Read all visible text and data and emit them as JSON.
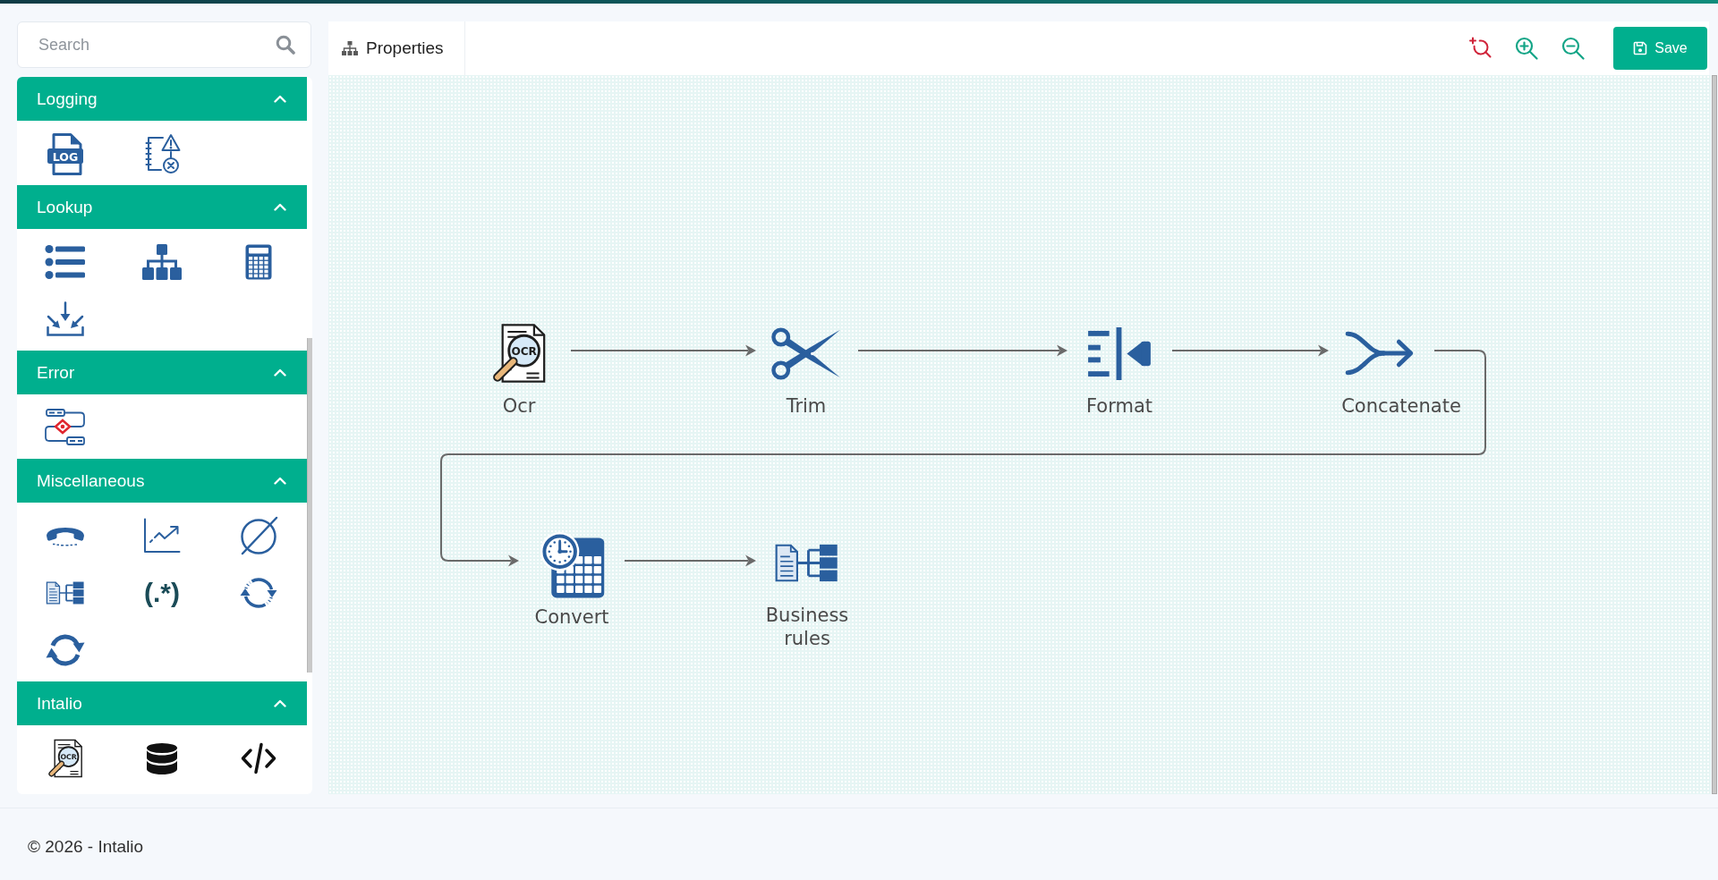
{
  "search": {
    "placeholder": "Search"
  },
  "sidebar": {
    "sections": [
      {
        "title": "Logging",
        "expanded": true,
        "items": [
          {
            "kind": "log",
            "badge": "LOG"
          },
          {
            "kind": "warning"
          }
        ]
      },
      {
        "title": "Lookup",
        "expanded": true,
        "items": [
          {
            "kind": "list"
          },
          {
            "kind": "tree"
          },
          {
            "kind": "calculator"
          },
          {
            "kind": "inbox"
          }
        ]
      },
      {
        "title": "Error",
        "expanded": true,
        "items": [
          {
            "kind": "errorflow"
          }
        ]
      },
      {
        "title": "Miscellaneous",
        "expanded": true,
        "items": [
          {
            "kind": "phone"
          },
          {
            "kind": "chart"
          },
          {
            "kind": "nullset"
          },
          {
            "kind": "rules"
          },
          {
            "kind": "regex",
            "glyph": "(.*)"
          },
          {
            "kind": "dashedsync"
          },
          {
            "kind": "sync"
          }
        ]
      },
      {
        "title": "Intalio",
        "expanded": true,
        "items": [
          {
            "kind": "ocr",
            "badge": "OCR"
          },
          {
            "kind": "database"
          },
          {
            "kind": "code"
          }
        ]
      }
    ]
  },
  "toolbar": {
    "tab": {
      "label": "Properties"
    },
    "save_button": {
      "label": "Save"
    }
  },
  "canvas": {
    "nodes": [
      {
        "kind": "ocr",
        "badge": "OCR",
        "label": "Ocr"
      },
      {
        "kind": "scissors",
        "label": "Trim"
      },
      {
        "kind": "format",
        "label": "Format"
      },
      {
        "kind": "merge",
        "label": "Concatenate"
      },
      {
        "kind": "calendar",
        "label": "Convert"
      },
      {
        "kind": "rules",
        "label": "Business rules"
      }
    ]
  },
  "footer": {
    "text": "© 2026 - Intalio"
  }
}
